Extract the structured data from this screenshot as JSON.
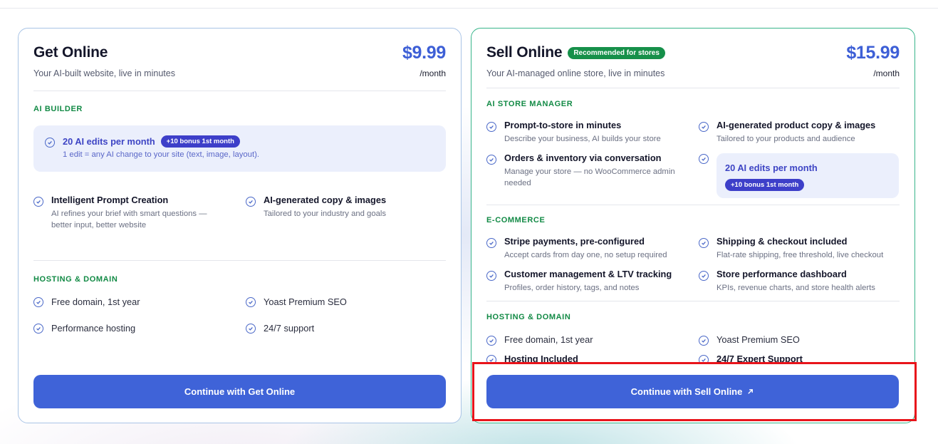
{
  "get_online": {
    "title": "Get Online",
    "subtitle": "Your AI-built website, live in minutes",
    "price": "$9.99",
    "period": "/month",
    "sections": {
      "ai_builder": "AI BUILDER",
      "hosting": "HOSTING & DOMAIN"
    },
    "highlight": {
      "title": "20 AI edits per month",
      "badge": "+10 bonus 1st month",
      "desc": "1 edit = any AI change to your site (text, image, layout)."
    },
    "features": [
      {
        "title": "Intelligent Prompt Creation",
        "desc": "AI refines your brief with smart questions — better input, better website"
      },
      {
        "title": "AI-generated copy & images",
        "desc": "Tailored to your industry and goals"
      }
    ],
    "hosting_items": [
      "Free domain, 1st year",
      "Yoast Premium SEO",
      "Performance hosting",
      "24/7 support"
    ],
    "cta": "Continue with Get Online"
  },
  "sell_online": {
    "title": "Sell Online",
    "badge": "Recommended for stores",
    "subtitle": "Your AI-managed online store, live in minutes",
    "price": "$15.99",
    "period": "/month",
    "sections": {
      "ai_store": "AI STORE MANAGER",
      "ecommerce": "E-COMMERCE",
      "hosting": "HOSTING & DOMAIN"
    },
    "ai_features": [
      {
        "title": "Prompt-to-store in minutes",
        "desc": "Describe your business, AI builds your store"
      },
      {
        "title": "AI-generated product copy & images",
        "desc": "Tailored to your products and audience"
      },
      {
        "title": "Orders & inventory via conversation",
        "desc": "Manage your store — no WooCommerce admin needed"
      }
    ],
    "highlight": {
      "title": "20 AI edits per month",
      "badge": "+10 bonus 1st month"
    },
    "ecom_features": [
      {
        "title": "Stripe payments, pre-configured",
        "desc": "Accept cards from day one, no setup required"
      },
      {
        "title": "Shipping & checkout included",
        "desc": "Flat-rate shipping, free threshold, live checkout"
      },
      {
        "title": "Customer management & LTV tracking",
        "desc": "Profiles, order history, tags, and notes"
      },
      {
        "title": "Store performance dashboard",
        "desc": "KPIs, revenue charts, and store health alerts"
      }
    ],
    "hosting_items": [
      "Free domain, 1st year",
      "Yoast Premium SEO",
      "Hosting Included",
      "24/7 Expert Support"
    ],
    "cta": "Continue with Sell Online",
    "cta_icon": "arrow-up-right-icon"
  },
  "colors": {
    "accent": "#3f63d8",
    "price": "#3d5fd6",
    "section": "#128a45",
    "recommended": "#16904a",
    "highlight_border": "#e8141b"
  }
}
